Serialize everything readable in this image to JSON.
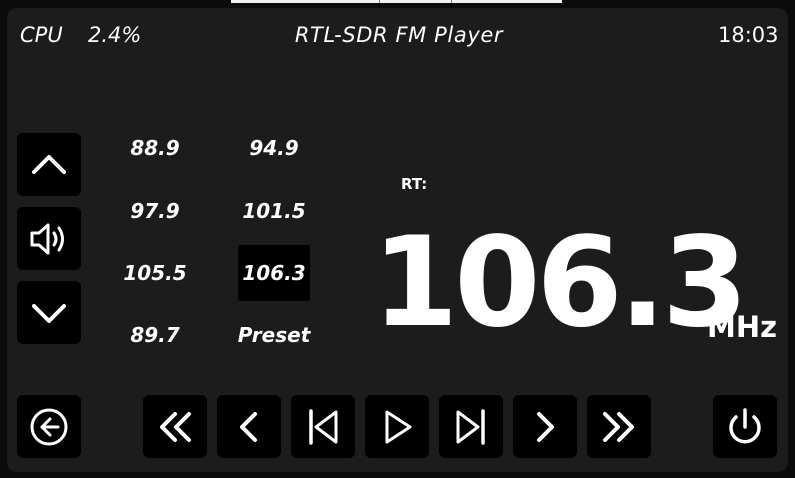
{
  "status": {
    "cpu_label": "CPU",
    "cpu_value": "2.4%",
    "title": "RTL-SDR FM Player",
    "clock": "18:03"
  },
  "presets": [
    {
      "label": "88.9",
      "selected": false
    },
    {
      "label": "94.9",
      "selected": false
    },
    {
      "label": "97.9",
      "selected": false
    },
    {
      "label": "101.5",
      "selected": false
    },
    {
      "label": "105.5",
      "selected": false
    },
    {
      "label": "106.3",
      "selected": true
    },
    {
      "label": "89.7",
      "selected": false
    },
    {
      "label": "Preset",
      "selected": false
    }
  ],
  "display": {
    "rt_label": "RT:",
    "rt_text": "",
    "frequency": "106.3",
    "unit": "MHz"
  },
  "icons": {
    "side": [
      "chevron-up-icon",
      "volume-icon",
      "chevron-down-icon"
    ],
    "back": "back-arrow-icon",
    "transport": [
      "rewind-fast-icon",
      "step-back-icon",
      "skip-previous-icon",
      "play-icon",
      "skip-next-icon",
      "step-forward-icon",
      "fast-forward-icon"
    ],
    "power": "power-icon"
  },
  "colors": {
    "background": "#1c1c1c",
    "button": "#000000",
    "text": "#ffffff"
  }
}
